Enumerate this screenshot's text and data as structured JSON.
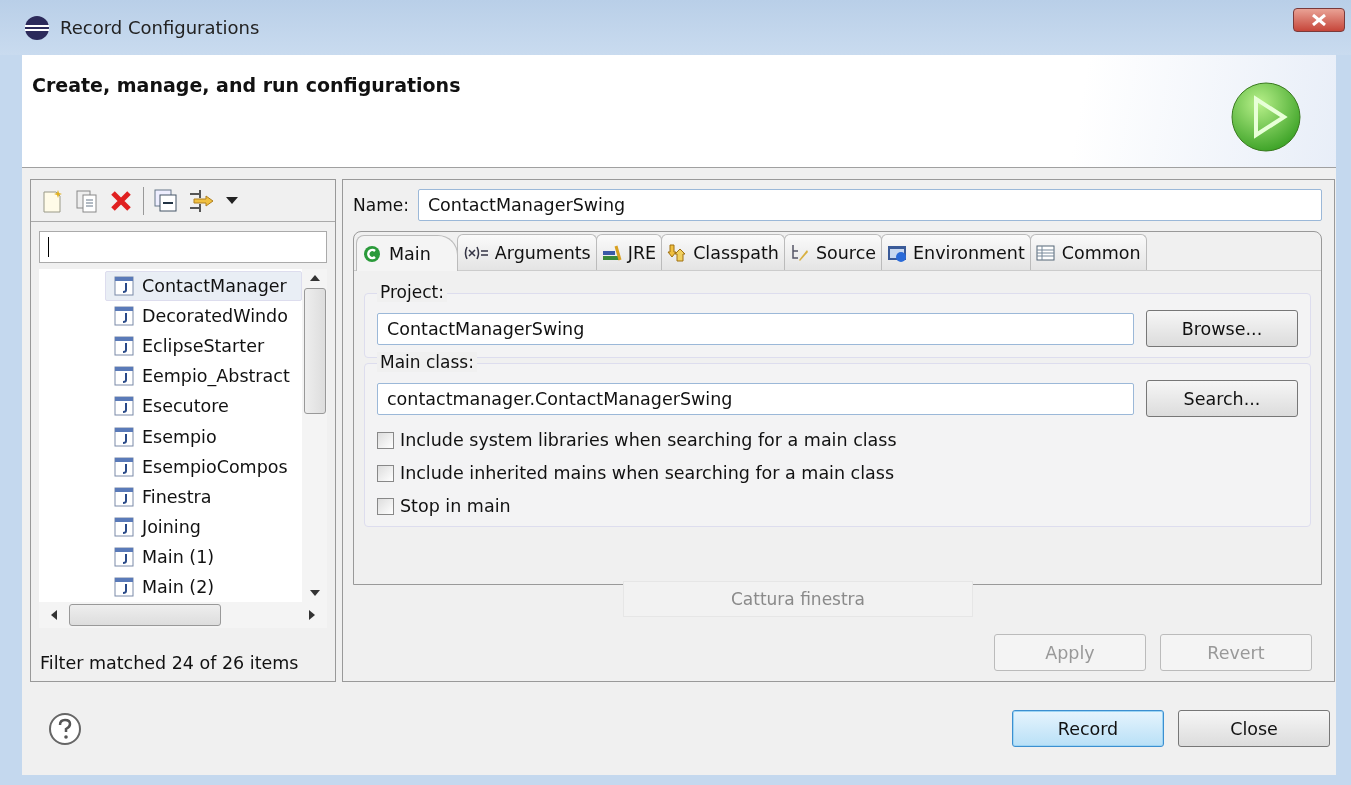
{
  "window": {
    "title": "Record Configurations"
  },
  "header": {
    "title": "Create, manage, and run configurations"
  },
  "tree": {
    "items": [
      {
        "label": "ContactManager",
        "selected": true
      },
      {
        "label": "DecoratedWindo",
        "selected": false
      },
      {
        "label": "EclipseStarter",
        "selected": false
      },
      {
        "label": "Eempio_Abstract",
        "selected": false
      },
      {
        "label": "Esecutore",
        "selected": false
      },
      {
        "label": "Esempio",
        "selected": false
      },
      {
        "label": "EsempioCompos",
        "selected": false
      },
      {
        "label": "Finestra",
        "selected": false
      },
      {
        "label": "Joining",
        "selected": false
      },
      {
        "label": "Main (1)",
        "selected": false
      },
      {
        "label": "Main (2)",
        "selected": false
      }
    ],
    "status": "Filter matched 24 of 26 items"
  },
  "name": {
    "label": "Name:",
    "value": "ContactManagerSwing"
  },
  "tabs": [
    {
      "label": "Main",
      "selected": true
    },
    {
      "label": "Arguments",
      "selected": false
    },
    {
      "label": "JRE",
      "selected": false
    },
    {
      "label": "Classpath",
      "selected": false
    },
    {
      "label": "Source",
      "selected": false
    },
    {
      "label": "Environment",
      "selected": false
    },
    {
      "label": "Common",
      "selected": false
    }
  ],
  "project": {
    "label": "Project:",
    "value": "ContactManagerSwing",
    "button": "Browse..."
  },
  "main_class": {
    "label": "Main class:",
    "value": "contactmanager.ContactManagerSwing",
    "button": "Search..."
  },
  "options": [
    {
      "label": "Include system libraries when searching for a main class",
      "checked": false
    },
    {
      "label": "Include inherited mains when searching for a main class",
      "checked": false
    },
    {
      "label": "Stop in main",
      "checked": false
    }
  ],
  "ghost_label": "Cattura finestra",
  "panel_buttons": [
    {
      "label": "Apply",
      "disabled": true
    },
    {
      "label": "Revert",
      "disabled": true
    }
  ],
  "footer_buttons": [
    {
      "label": "Record",
      "default": true
    },
    {
      "label": "Close",
      "default": false
    }
  ]
}
